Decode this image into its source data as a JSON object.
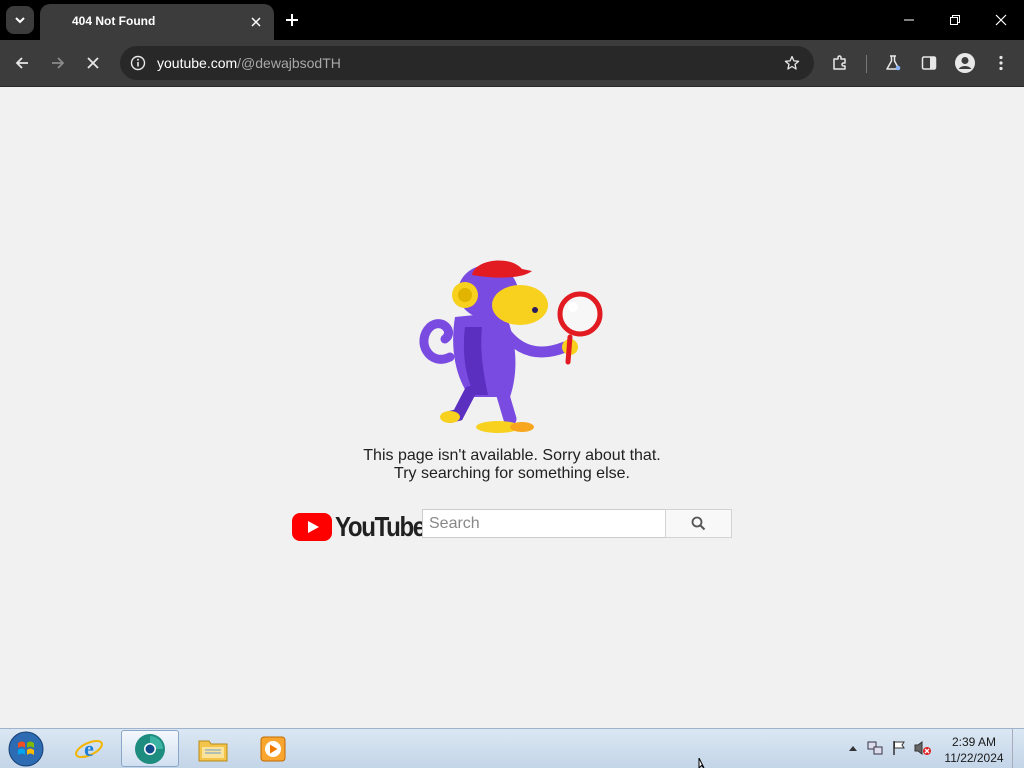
{
  "browser": {
    "tab_title": "404 Not Found",
    "url_host": "youtube.com",
    "url_path": "/@dewajbsodTH"
  },
  "page": {
    "message_line1": "This page isn't available. Sorry about that.",
    "message_line2": "Try searching for something else.",
    "logo_text": "YouTube",
    "search_placeholder": "Search"
  },
  "taskbar": {
    "time": "2:39 AM",
    "date": "11/22/2024"
  },
  "colors": {
    "youtube_red": "#ff0000",
    "monkey_purple": "#7a4be0",
    "monkey_yellow": "#f7d11e",
    "hat_red": "#e21b23"
  },
  "icons": [
    "tab-search-icon",
    "close-icon",
    "plus-icon",
    "minimize-icon",
    "restore-icon",
    "back-icon",
    "forward-icon",
    "stop-icon",
    "info-icon",
    "star-icon",
    "extensions-icon",
    "labs-icon",
    "side-panel-icon",
    "profile-icon",
    "more-icon",
    "search-icon",
    "windows-start-icon",
    "ie-icon",
    "chrome-beta-icon",
    "folder-icon",
    "media-player-icon"
  ]
}
